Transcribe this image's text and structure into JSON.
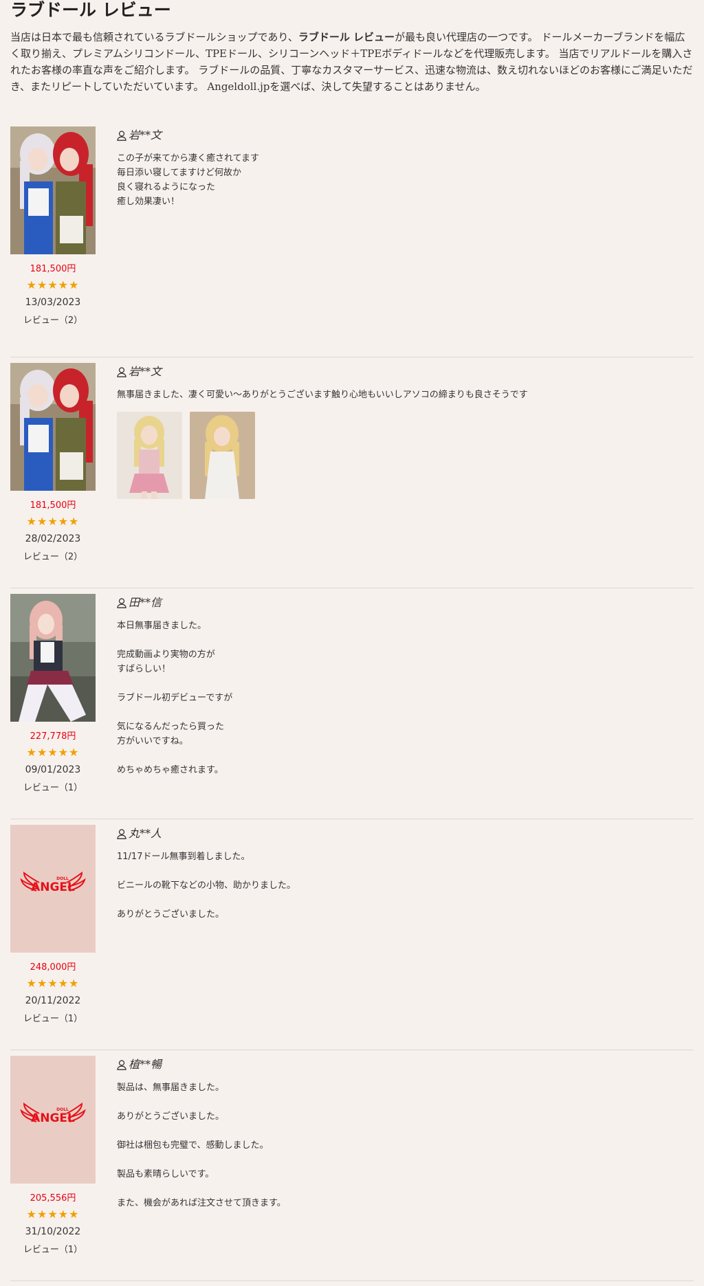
{
  "page": {
    "title": "ラブドール レビュー",
    "intro_part1": "当店は日本で最も信頼されているラブドールショップであり、",
    "intro_bold": "ラブドール レビュー",
    "intro_part2": "が最も良い代理店の一つです。 ドールメーカーブランドを幅広く取り揃え、プレミアムシリコンドール、TPEドール、シリコーンヘッド＋TPEボディドールなどを代理販売します。 当店でリアルドールを購入されたお客様の率直な声をご紹介します。 ラブドールの品質、丁寧なカスタマーサービス、迅速な物流は、数え切れないほどのお客様にご満足いただき、またリピートしていただいています。 Angeldoll.jpを選べば、決して失望することはありません。"
  },
  "colors": {
    "background": "#f7f1ed",
    "price": "#e60012",
    "stars": "#f0a000",
    "logo": "#e8101a"
  },
  "reviews": [
    {
      "thumb": "photo-maid-duo",
      "price": "181,500円",
      "stars": "★★★★★",
      "rating": 5,
      "date": "13/03/2023",
      "review_count": "レビュー（2）",
      "author": "岩**文",
      "text": "この子が来てから凄く癒されてます\n毎日添い寝してますけど何故か\n良く寝れるようになった\n癒し効果凄い！",
      "photos": []
    },
    {
      "thumb": "photo-maid-duo",
      "price": "181,500円",
      "stars": "★★★★★",
      "rating": 5,
      "date": "28/02/2023",
      "review_count": "レビュー（2）",
      "author": "岩**文",
      "text": "無事届きました、凄く可愛い～ありがとうございます触り心地もいいしアソコの締まりも良さそうです",
      "photos": [
        "photo-pink-dress",
        "photo-white-dress"
      ]
    },
    {
      "thumb": "photo-schoolgirl",
      "price": "227,778円",
      "stars": "★★★★★",
      "rating": 5,
      "date": "09/01/2023",
      "review_count": "レビュー（1）",
      "author": "田**信",
      "text": "本日無事届きました。\n\n完成動画より実物の方が\nすばらしい！\n\nラブドール初デビューですが\n\n気になるんだったら買った\n方がいいですね。\n\nめちゃめちゃ癒されます。",
      "photos": []
    },
    {
      "thumb": "angel-logo",
      "price": "248,000円",
      "stars": "★★★★★",
      "rating": 5,
      "date": "20/11/2022",
      "review_count": "レビュー（1）",
      "author": "丸**人",
      "text": "11/17ドール無事到着しました。\n\nビニールの靴下などの小物、助かりました。\n\nありがとうございました。",
      "photos": []
    },
    {
      "thumb": "angel-logo",
      "price": "205,556円",
      "stars": "★★★★★",
      "rating": 5,
      "date": "31/10/2022",
      "review_count": "レビュー（1）",
      "author": "植**暢",
      "text": "製品は、無事届きました。\n\nありがとうございました。\n\n御社は梱包も完璧で、感動しました。\n\n製品も素晴らしいです。\n\nまた、機会があれば注文させて頂きます。",
      "photos": []
    }
  ],
  "logo": {
    "word": "ANGEL",
    "small": "DOLL"
  }
}
